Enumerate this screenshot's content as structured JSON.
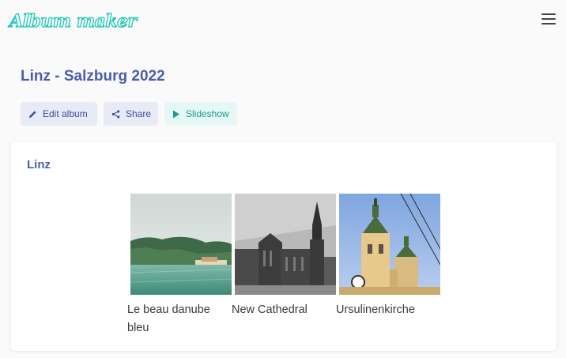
{
  "app": {
    "logo": "Album maker"
  },
  "album": {
    "title": "Linz - Salzburg 2022"
  },
  "actions": {
    "edit_label": "Edit album",
    "share_label": "Share",
    "slideshow_label": "Slideshow"
  },
  "sections": [
    {
      "title": "Linz",
      "photos": [
        {
          "caption": "Le beau danube bleu"
        },
        {
          "caption": "New Cathedral"
        },
        {
          "caption": "Ursulinenkirche"
        }
      ]
    }
  ],
  "colors": {
    "accent": "#4a5dab",
    "logo": "#1fc4b6",
    "slideshow": "#1b9b8a",
    "button_bg": "#e8ebf6",
    "slideshow_bg": "#e6f8f5"
  }
}
